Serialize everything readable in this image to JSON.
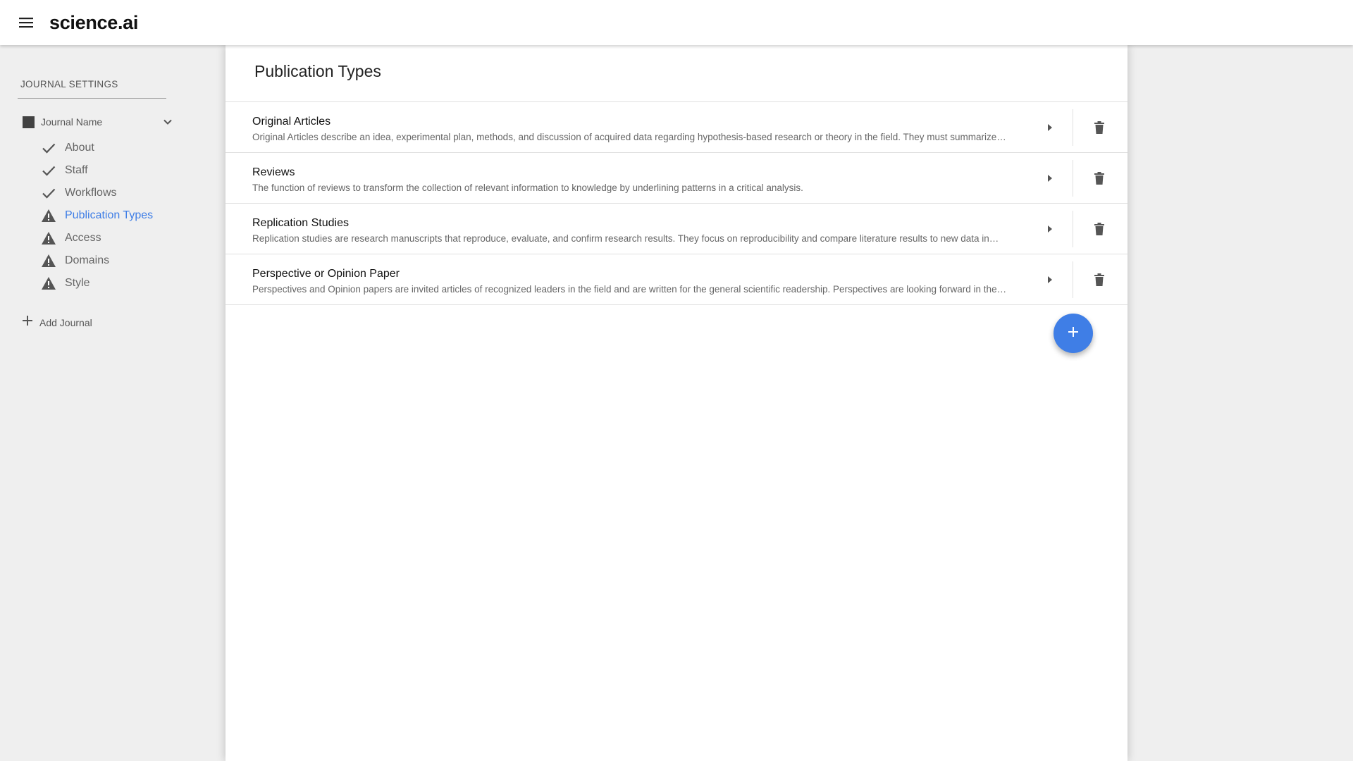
{
  "app": {
    "brand": "science.ai",
    "menu_icon": "hamburger-menu-icon"
  },
  "sidebar": {
    "heading": "JOURNAL SETTINGS",
    "journal": {
      "name": "Journal Name",
      "swatch_color": "#424242",
      "expanded": true
    },
    "items": [
      {
        "label": "About",
        "status": "complete",
        "icon": "check-icon"
      },
      {
        "label": "Staff",
        "status": "complete",
        "icon": "check-icon"
      },
      {
        "label": "Workflows",
        "status": "complete",
        "icon": "check-icon"
      },
      {
        "label": "Publication Types",
        "status": "warning",
        "icon": "warning-icon",
        "active": true
      },
      {
        "label": "Access",
        "status": "warning",
        "icon": "warning-icon"
      },
      {
        "label": "Domains",
        "status": "warning",
        "icon": "warning-icon"
      },
      {
        "label": "Style",
        "status": "warning",
        "icon": "warning-icon"
      }
    ],
    "add_journal_label": "Add Journal"
  },
  "main": {
    "title": "Publication Types",
    "publication_types": [
      {
        "title": "Original Articles",
        "description": "Original Articles describe an idea, experimental plan, methods, and discussion of acquired data regarding hypothesis-based research or theory in the field. They must summarize…"
      },
      {
        "title": "Reviews",
        "description": "The function of reviews to transform the collection of relevant information to knowledge by underlining patterns in a critical analysis."
      },
      {
        "title": "Replication Studies",
        "description": "Replication studies are research manuscripts that reproduce, evaluate, and confirm research results. They focus on reproducibility and compare literature results to new data in…"
      },
      {
        "title": "Perspective or Opinion Paper",
        "description": "Perspectives and Opinion papers are invited articles of recognized leaders in the field and are written for the general scientific readership. Perspectives are looking forward in the…"
      }
    ],
    "add_button_icon": "plus-icon"
  },
  "colors": {
    "accent": "#3f7ee6",
    "background": "#efefef",
    "panel": "#ffffff"
  }
}
